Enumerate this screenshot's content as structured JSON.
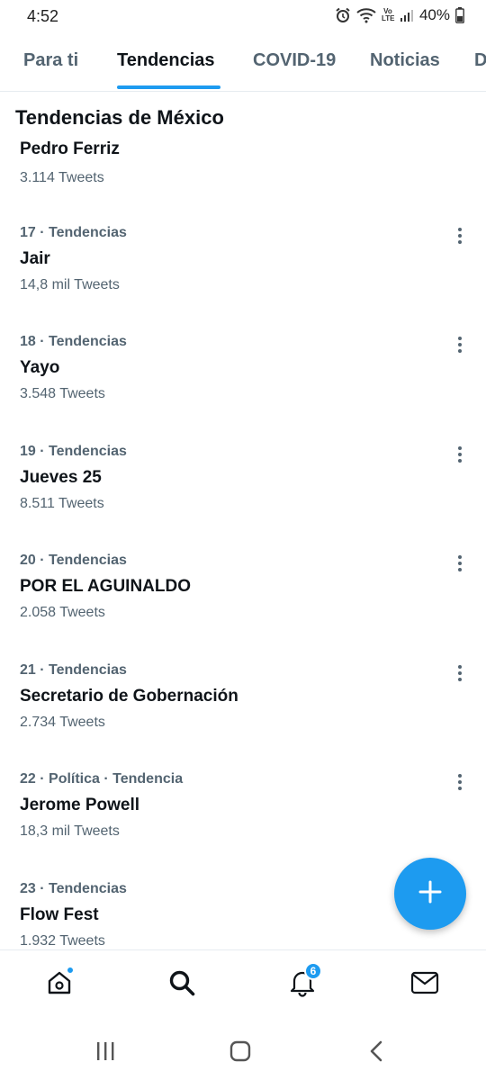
{
  "status": {
    "time": "4:52",
    "battery": "40%",
    "lte_label": "Vo LTE"
  },
  "tabs": [
    {
      "label": "Para ti"
    },
    {
      "label": "Tendencias",
      "active": true
    },
    {
      "label": "COVID-19"
    },
    {
      "label": "Noticias"
    },
    {
      "label": "D"
    }
  ],
  "section": {
    "title": "Tendencias de México"
  },
  "partial_trend": {
    "name": "Pedro Ferriz",
    "count": "3.114 Tweets"
  },
  "trends": [
    {
      "meta": "17 · Tendencias",
      "name": "Jair",
      "count": "14,8 mil Tweets"
    },
    {
      "meta": "18 · Tendencias",
      "name": "Yayo",
      "count": "3.548 Tweets"
    },
    {
      "meta": "19 · Tendencias",
      "name": "Jueves 25",
      "count": "8.511 Tweets"
    },
    {
      "meta": "20 · Tendencias",
      "name": "POR EL AGUINALDO",
      "count": "2.058 Tweets"
    },
    {
      "meta": "21 · Tendencias",
      "name": "Secretario de Gobernación",
      "count": "2.734 Tweets"
    },
    {
      "meta": "22 · Política · Tendencia",
      "name": "Jerome Powell",
      "count": "18,3 mil Tweets"
    },
    {
      "meta": "23 · Tendencias",
      "name": "Flow Fest",
      "count": "1.932 Tweets"
    }
  ],
  "bottom_nav": {
    "notifications_badge": "6",
    "items": [
      "home-icon",
      "search-icon",
      "notifications-icon",
      "messages-icon"
    ]
  },
  "colors": {
    "accent": "#1d9bf0",
    "secondary_text": "#536471",
    "primary_text": "#0f1419"
  }
}
